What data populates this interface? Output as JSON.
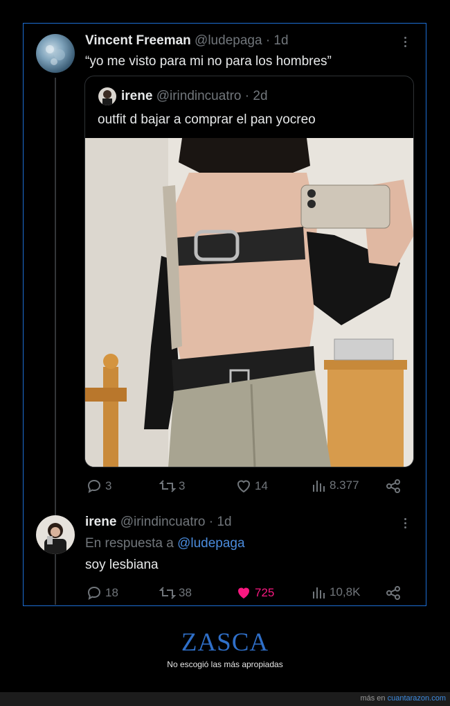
{
  "tweet1": {
    "name": "Vincent Freeman",
    "handle": "@ludepaga",
    "time": "· 1d",
    "text": "“yo me visto para mi no para los hombres”"
  },
  "quoted": {
    "name": "irene",
    "handle": "@irindincuatro",
    "time": "· 2d",
    "text": "outfit d bajar a comprar el pan yocreo"
  },
  "tweet1_actions": {
    "replies": "3",
    "retweets": "3",
    "likes": "14",
    "views": "8.377"
  },
  "tweet2": {
    "name": "irene",
    "handle": "@irindincuatro",
    "time": "· 1d",
    "reply_prefix": "En respuesta a",
    "reply_to": "@ludepaga",
    "text": "soy lesbiana"
  },
  "tweet2_actions": {
    "replies": "18",
    "retweets": "38",
    "likes": "725",
    "views": "10,8K"
  },
  "colors": {
    "like_active": "#f91880",
    "link": "#4a8bdc",
    "frame_border": "#1d6fd6",
    "zasca": "#2f6fc8"
  },
  "meme": {
    "title": "ZASCA",
    "caption": "No escogió las más apropiadas"
  },
  "footer": {
    "prefix": "más en",
    "site": "cuantarazon.com"
  }
}
